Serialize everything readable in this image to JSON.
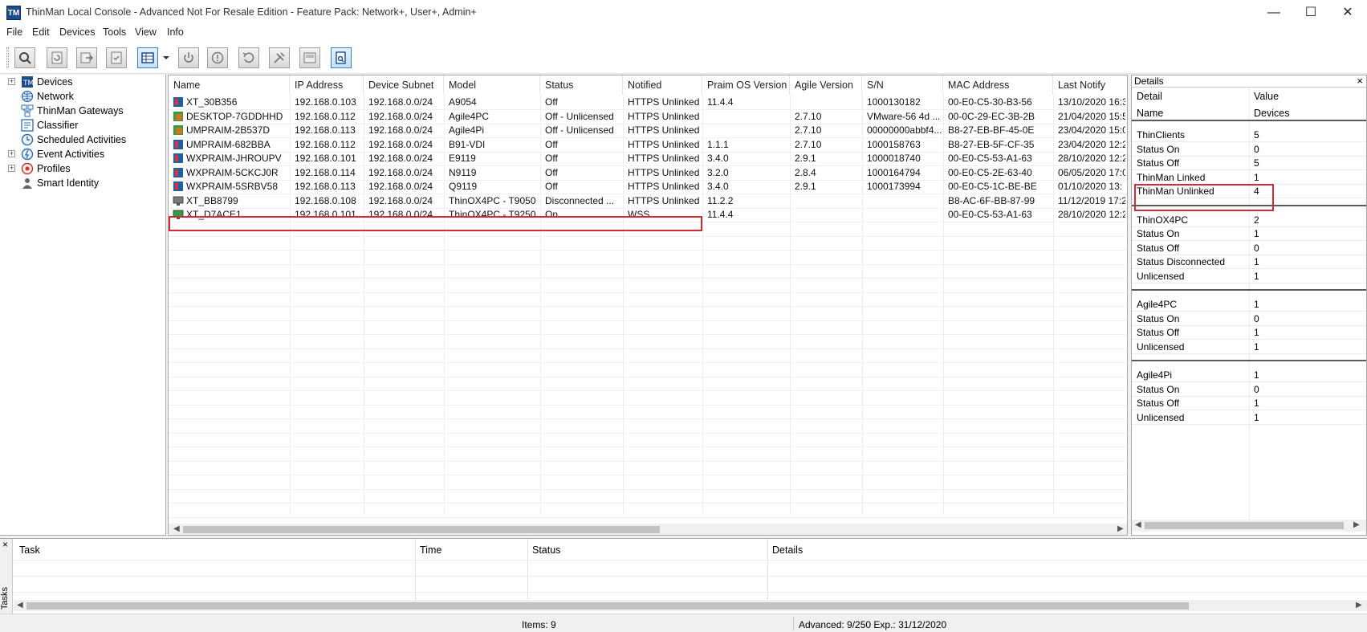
{
  "window": {
    "title": "ThinMan Local Console - Advanced Not For Resale Edition - Feature Pack: Network+, User+, Admin+",
    "app_icon": "TM",
    "minimize": "—",
    "maximize": "☐",
    "close": "✕"
  },
  "menu": [
    "File",
    "Edit",
    "Devices",
    "Tools",
    "View",
    "Info"
  ],
  "toolbar_icons": [
    "search-icon",
    "refresh-icon",
    "export-icon",
    "check-icon",
    "grid-view-icon",
    "dropdown-icon",
    "power-icon",
    "info-icon",
    "undo-icon",
    "settings-tool-icon",
    "message-icon",
    "search-document-icon"
  ],
  "tree": [
    {
      "label": "Devices",
      "icon": "devices-icon",
      "expandable": true
    },
    {
      "label": "Network",
      "icon": "network-icon",
      "expandable": false
    },
    {
      "label": "ThinMan Gateways",
      "icon": "gateway-icon",
      "expandable": false
    },
    {
      "label": "Classifier",
      "icon": "classifier-icon",
      "expandable": false
    },
    {
      "label": "Scheduled Activities",
      "icon": "clock-icon",
      "expandable": false
    },
    {
      "label": "Event Activities",
      "icon": "event-icon",
      "expandable": true
    },
    {
      "label": "Profiles",
      "icon": "profiles-icon",
      "expandable": true
    },
    {
      "label": "Smart Identity",
      "icon": "user-icon",
      "expandable": false
    }
  ],
  "grid": {
    "columns": [
      "Name",
      "IP Address",
      "Device Subnet",
      "Model",
      "Status",
      "Notified",
      "Praim OS Version",
      "Agile Version",
      "S/N",
      "MAC Address",
      "Last Notify"
    ],
    "rows": [
      {
        "icon": "thinclient-blue",
        "cells": [
          "XT_30B356",
          "192.168.0.103",
          "192.168.0.0/24",
          "A9054",
          "Off",
          "HTTPS Unlinked",
          "11.4.4",
          "",
          "1000130182",
          "00-E0-C5-30-B3-56",
          "13/10/2020 16:3"
        ]
      },
      {
        "icon": "agile-orange",
        "cells": [
          "DESKTOP-7GDDHHD",
          "192.168.0.112",
          "192.168.0.0/24",
          "Agile4PC",
          "Off - Unlicensed",
          "HTTPS Unlinked",
          "",
          "2.7.10",
          "VMware-56 4d ...",
          "00-0C-29-EC-3B-2B",
          "21/04/2020 15:5"
        ]
      },
      {
        "icon": "agile-orange",
        "cells": [
          "UMPRAIM-2B537D",
          "192.168.0.113",
          "192.168.0.0/24",
          "Agile4Pi",
          "Off - Unlicensed",
          "HTTPS Unlinked",
          "",
          "2.7.10",
          "00000000abbf4...",
          "B8-27-EB-BF-45-0E",
          "23/04/2020 15:0"
        ]
      },
      {
        "icon": "thinclient-blue",
        "cells": [
          "UMPRAIM-682BBA",
          "192.168.0.112",
          "192.168.0.0/24",
          "B91-VDI",
          "Off",
          "HTTPS Unlinked",
          "1.1.1",
          "2.7.10",
          "1000158763",
          "B8-27-EB-5F-CF-35",
          "23/04/2020 12:2"
        ]
      },
      {
        "icon": "thinclient-blue",
        "cells": [
          "WXPRAIM-JHROUPV",
          "192.168.0.101",
          "192.168.0.0/24",
          "E9119",
          "Off",
          "HTTPS Unlinked",
          "3.4.0",
          "2.9.1",
          "1000018740",
          "00-E0-C5-53-A1-63",
          "28/10/2020 12:2"
        ]
      },
      {
        "icon": "thinclient-blue",
        "cells": [
          "WXPRAIM-5CKCJ0R",
          "192.168.0.114",
          "192.168.0.0/24",
          "N9119",
          "Off",
          "HTTPS Unlinked",
          "3.2.0",
          "2.8.4",
          "1000164794",
          "00-E0-C5-2E-63-40",
          "06/05/2020 17:0"
        ]
      },
      {
        "icon": "thinclient-blue",
        "cells": [
          "WXPRAIM-5SRBV58",
          "192.168.0.113",
          "192.168.0.0/24",
          "Q9119",
          "Off",
          "HTTPS Unlinked",
          "3.4.0",
          "2.9.1",
          "1000173994",
          "00-E0-C5-1C-BE-BE",
          "01/10/2020 13:"
        ]
      },
      {
        "icon": "monitor-gray",
        "cells": [
          "XT_BB8799",
          "192.168.0.108",
          "192.168.0.0/24",
          "ThinOX4PC - T9050",
          "Disconnected ...",
          "HTTPS Unlinked",
          "11.2.2",
          "",
          "",
          "B8-AC-6F-BB-87-99",
          "11/12/2019 17:2"
        ]
      },
      {
        "icon": "monitor-green",
        "cells": [
          "XT_D7ACE1",
          "192.168.0.101",
          "192.168.0.0/24",
          "ThinOX4PC - T9250",
          "On",
          "WSS",
          "11.4.4",
          "",
          "",
          "00-E0-C5-53-A1-63",
          "28/10/2020 12:2"
        ]
      }
    ]
  },
  "details": {
    "title": "Details",
    "close": "×",
    "header": {
      "col1": "Detail",
      "col2": "Value",
      "sub1": "Name",
      "sub2": "Devices"
    },
    "groups": [
      [
        [
          "ThinClients",
          "5"
        ],
        [
          "Status On",
          "0"
        ],
        [
          "Status Off",
          "5"
        ],
        [
          "ThinMan Linked",
          "1"
        ],
        [
          "ThinMan Unlinked",
          "4"
        ]
      ],
      [
        [
          "ThinOX4PC",
          "2"
        ],
        [
          "Status On",
          "1"
        ],
        [
          "Status Off",
          "0"
        ],
        [
          "Status Disconnected",
          "1"
        ],
        [
          "Unlicensed",
          "1"
        ]
      ],
      [
        [
          "Agile4PC",
          "1"
        ],
        [
          "Status On",
          "0"
        ],
        [
          "Status Off",
          "1"
        ],
        [
          "Unlicensed",
          "1"
        ]
      ],
      [
        [
          "Agile4Pi",
          "1"
        ],
        [
          "Status On",
          "0"
        ],
        [
          "Status Off",
          "1"
        ],
        [
          "Unlicensed",
          "1"
        ]
      ]
    ]
  },
  "tasks": {
    "tab_label": "Tasks",
    "close": "×",
    "columns": [
      "Task",
      "Time",
      "Status",
      "Details"
    ]
  },
  "statusbar": {
    "items": "Items: 9",
    "license": "Advanced: 9/250 Exp.: 31/12/2020"
  },
  "colors": {
    "highlight": "#d42a33",
    "thinclient_blue": "#1f5fa8",
    "agile_orange": "#d4731c",
    "monitor_green": "#2e9e46"
  }
}
